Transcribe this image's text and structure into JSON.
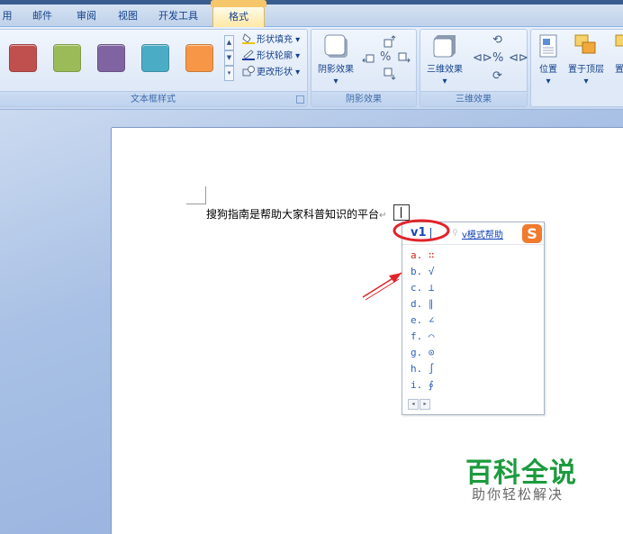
{
  "tabs": [
    {
      "label": "用",
      "active": false
    },
    {
      "label": "邮件",
      "active": false
    },
    {
      "label": "审阅",
      "active": false
    },
    {
      "label": "视图",
      "active": false
    },
    {
      "label": "开发工具",
      "active": false
    },
    {
      "label": "格式",
      "active": true
    }
  ],
  "ribbon": {
    "textbox_styles": {
      "label": "文本框样式",
      "swatch_colors": [
        "#c0504d",
        "#9bbb59",
        "#8064a2",
        "#4bacc6",
        "#f79646"
      ],
      "shape_fill": "形状填充",
      "shape_outline": "形状轮廓",
      "change_shape": "更改形状"
    },
    "shadow_effects": {
      "label": "阴影效果",
      "button": "阴影效果"
    },
    "three_d_effects": {
      "label": "三维效果",
      "button": "三维效果"
    },
    "arrange": {
      "position": "位置",
      "bring_to_front": "置于顶层",
      "cut_off": "置于"
    }
  },
  "document": {
    "text": "搜狗指南是帮助大家科普知识的平台",
    "paragraph_mark": "↵"
  },
  "ime": {
    "composition": "v1",
    "help_link": "v模式帮助",
    "logo_letter": "S",
    "accent_color": "#f07a2e",
    "candidates": [
      {
        "label": "a. ∷"
      },
      {
        "label": "b. √"
      },
      {
        "label": "c. ⊥"
      },
      {
        "label": "d. ∥"
      },
      {
        "label": "e. ∠"
      },
      {
        "label": "f. ⌒"
      },
      {
        "label": "g. ⊙"
      },
      {
        "label": "h. ∫"
      },
      {
        "label": "i. ∮"
      }
    ],
    "pager": [
      "◂",
      "▸"
    ]
  },
  "watermark": {
    "title": "百科全说",
    "subtitle": "助你轻松解决"
  }
}
